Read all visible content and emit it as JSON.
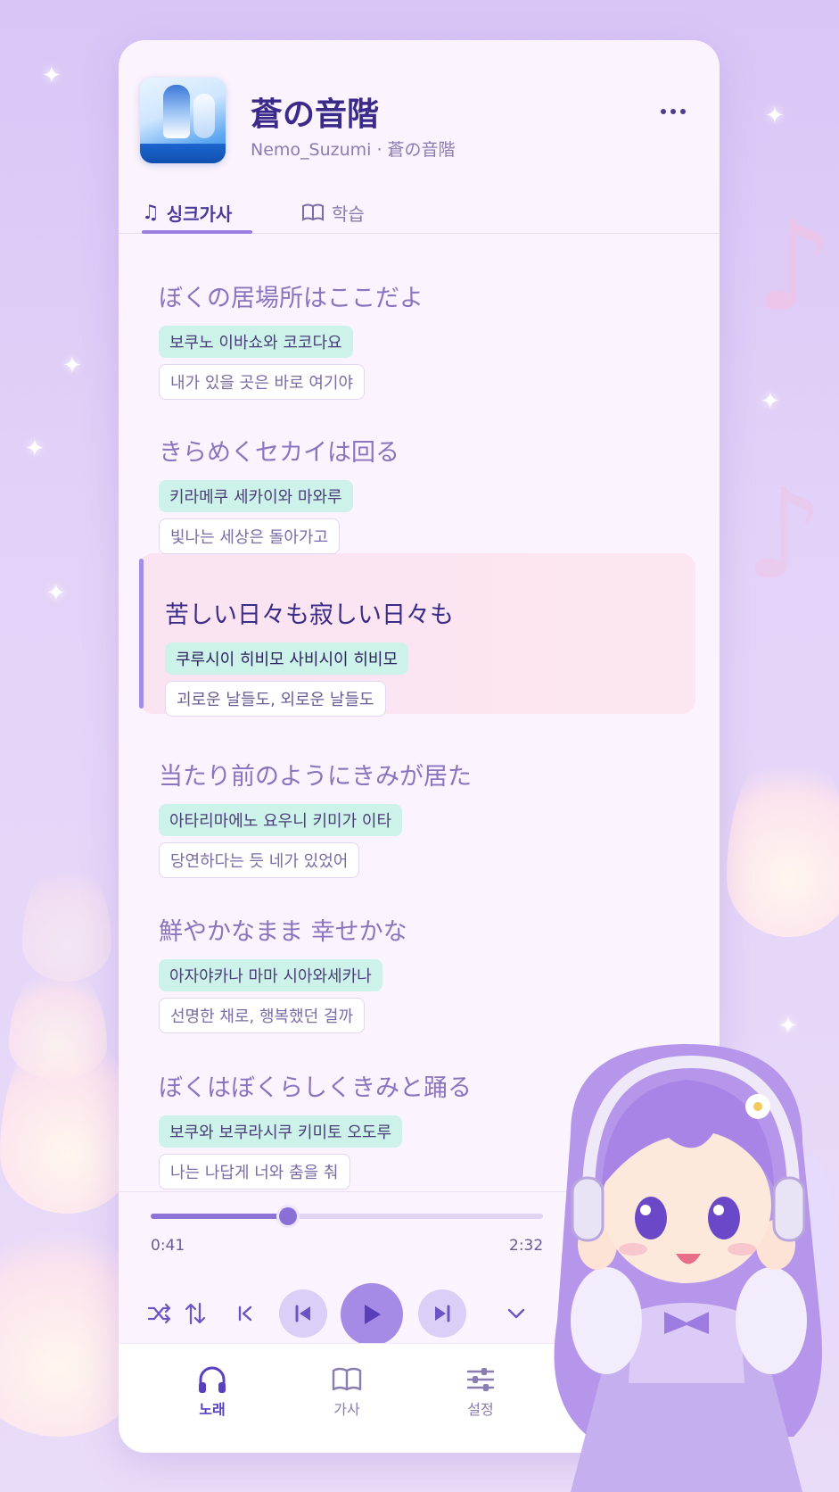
{
  "song": {
    "title": "蒼の音階",
    "subtitle": "Nemo_Suzumi · 蒼の音階"
  },
  "tabs": [
    {
      "label": "싱크가사",
      "icon": "music-note-icon",
      "active": true
    },
    {
      "label": "학습",
      "icon": "book-icon",
      "active": false
    }
  ],
  "lyrics": [
    {
      "jp": "ぼくの居場所はここだよ",
      "romanization": "보쿠노 이바쇼와 코코다요",
      "translation": "내가 있을 곳은 바로 여기야"
    },
    {
      "jp": "きらめくセカイは回る",
      "romanization": "키라메쿠 세카이와 마와루",
      "translation": "빛나는 세상은 돌아가고"
    },
    {
      "jp": "苦しい日々も寂しい日々も",
      "romanization": "쿠루시이 히비모 사비시이 히비모",
      "translation": "괴로운 날들도, 외로운 날들도",
      "active": true
    },
    {
      "jp": "当たり前のようにきみが居た",
      "romanization": "아타리마에노 요우니 키미가 이타",
      "translation": "당연하다는 듯 네가 있었어"
    },
    {
      "jp": "鮮やかなまま 幸せかな",
      "romanization": "아자야카나 마마 시아와세카나",
      "translation": "선명한 채로, 행복했던 걸까"
    },
    {
      "jp": "ぼくはぼくらしくきみと踊る",
      "romanization": "보쿠와 보쿠라시쿠 키미토 오도루",
      "translation": "나는 나답게 너와 춤을 춰"
    }
  ],
  "player": {
    "current_time": "0:41",
    "total_time": "2:32",
    "progress": 0.35
  },
  "bottom_nav": [
    {
      "label": "노래",
      "icon": "headphones-icon",
      "active": true
    },
    {
      "label": "가사",
      "icon": "book-icon",
      "active": false
    },
    {
      "label": "설정",
      "icon": "sliders-icon",
      "active": false
    }
  ],
  "colors": {
    "accent": "#8d72d8",
    "title": "#3a2a8a",
    "romanization_bg": "#cdf2e9",
    "active_line_bg": "#fbe4f2"
  }
}
